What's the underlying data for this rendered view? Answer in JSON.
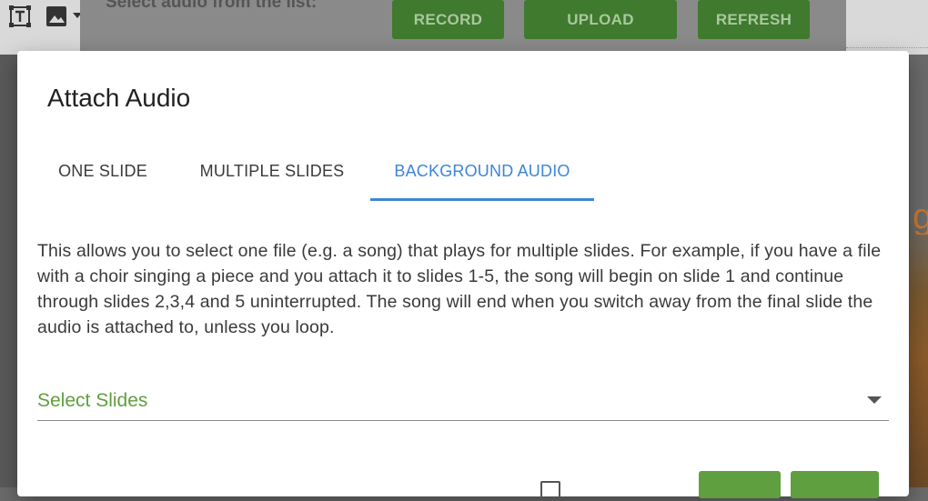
{
  "background": {
    "toolbar": {
      "icons": [
        "text-tool-icon",
        "image-icon",
        "chevron-down-icon"
      ]
    },
    "panel": {
      "title": "Select audio from the list:",
      "buttons": {
        "record": "RECORD",
        "upload": "UPLOAD",
        "refresh": "REFRESH"
      }
    }
  },
  "modal": {
    "title": "Attach Audio",
    "tabs": [
      {
        "label": "ONE SLIDE",
        "active": false
      },
      {
        "label": "MULTIPLE SLIDES",
        "active": false
      },
      {
        "label": "BACKGROUND AUDIO",
        "active": true
      }
    ],
    "description": "This allows you to select one file (e.g. a song) that plays for multiple slides. For example, if you have a file with a choir singing a piece and you attach it to slides 1-5, the song will begin on slide 1 and continue through slides 2,3,4 and 5 uninterrupted. The song will end when you switch away from the final slide the audio is attached to, unless you loop.",
    "select": {
      "placeholder": "Select Slides"
    },
    "loop_checkbox": {
      "checked": false
    }
  },
  "colors": {
    "accent_blue": "#3d86d6",
    "accent_green": "#5f9f3f",
    "button_green": "#3f7a2e"
  }
}
